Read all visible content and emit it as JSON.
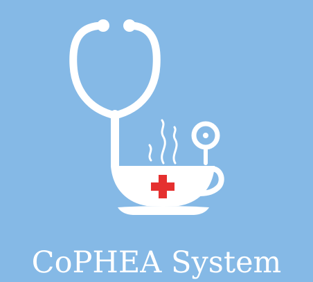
{
  "brand": {
    "name": "CoPHEA System",
    "logo_icon": "stethoscope-teacup-icon"
  },
  "colors": {
    "background": "#85b9e6",
    "logo": "#ffffff",
    "cross": "#e5302f"
  }
}
